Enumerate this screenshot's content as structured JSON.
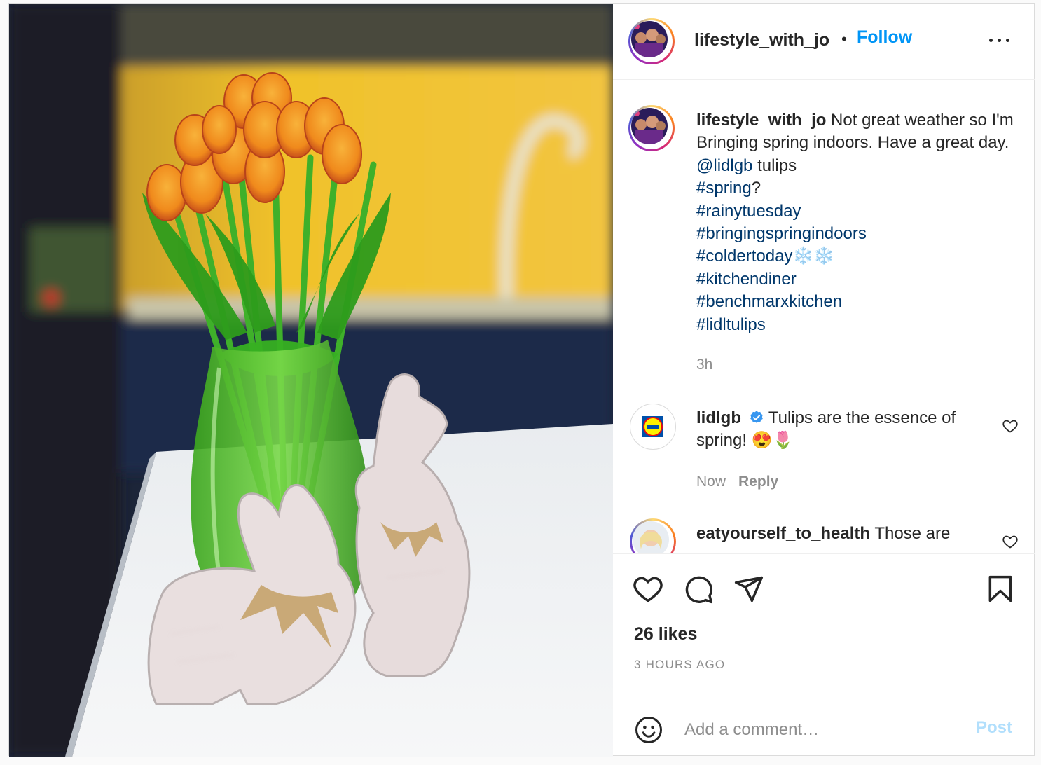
{
  "post": {
    "username": "lifestyle_with_jo",
    "follow_label": "Follow",
    "separator": "•",
    "more_icon": "more-horizontal-icon",
    "caption": {
      "username": "lifestyle_with_jo",
      "text_1": " Not great weather so I'm Bringing spring indoors. Have a great day. ",
      "mention": "@lidlgb",
      "text_2": " tulips",
      "hashtag_spring": "#spring",
      "after_spring": "?",
      "hashtags": [
        "#rainytuesday",
        "#bringingspringindoors",
        "#coldertoday",
        "#kitchendiner",
        "#benchmarxkitchen",
        "#lidltulips"
      ],
      "coldertoday_emoji": "❄️❄️"
    },
    "caption_time": "3h"
  },
  "comments": [
    {
      "username": "lidlgb",
      "verified": true,
      "text": " Tulips are the essence of spring! 😍🌷",
      "time": "Now",
      "reply_label": "Reply"
    },
    {
      "username": "eatyourself_to_health",
      "text": " Those are"
    }
  ],
  "actions": {
    "like_icon": "heart-icon",
    "comment_icon": "comment-icon",
    "share_icon": "paper-plane-icon",
    "save_icon": "bookmark-icon",
    "likes": "26 likes",
    "posted_ago": "3 HOURS AGO"
  },
  "add_comment": {
    "placeholder": "Add a comment…",
    "post_label": "Post",
    "emoji_icon": "smiley-icon"
  },
  "colors": {
    "accent": "#0095f6",
    "link": "#00376b",
    "muted": "#8e8e8e",
    "post_disabled": "#b2dffc"
  }
}
